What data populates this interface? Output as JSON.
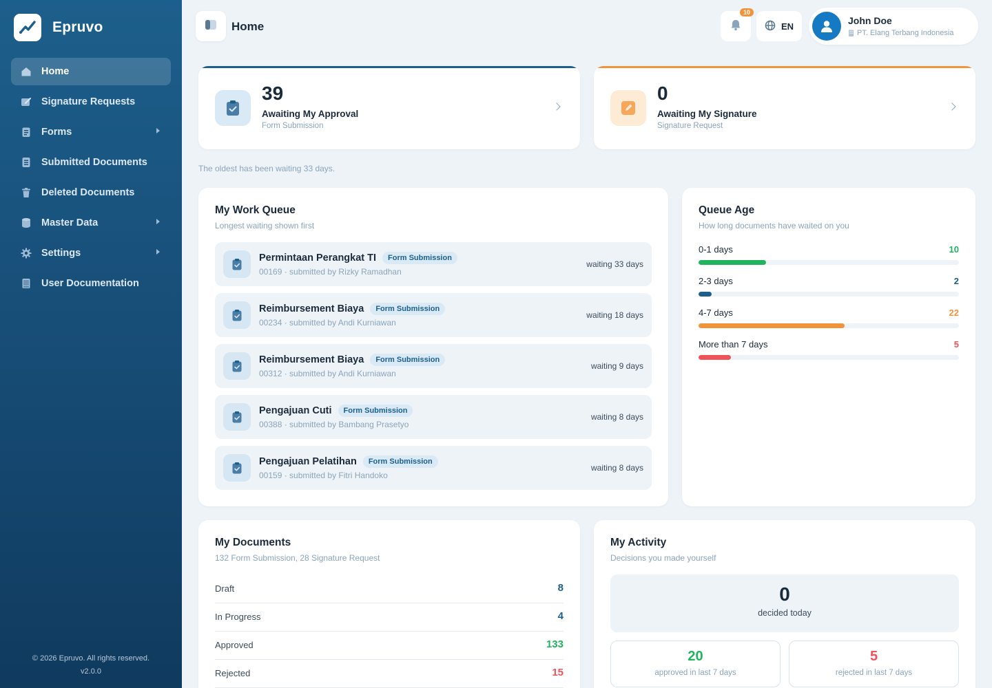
{
  "brand": {
    "name": "Epruvo"
  },
  "sidebar": {
    "items": [
      {
        "label": "Home",
        "icon": "home-icon"
      },
      {
        "label": "Signature Requests",
        "icon": "pen-icon"
      },
      {
        "label": "Forms",
        "icon": "form-icon"
      },
      {
        "label": "Submitted Documents",
        "icon": "document-icon"
      },
      {
        "label": "Deleted Documents",
        "icon": "trash-icon"
      },
      {
        "label": "Master Data",
        "icon": "database-icon"
      },
      {
        "label": "Settings",
        "icon": "gear-icon"
      },
      {
        "label": "User Documentation",
        "icon": "book-icon"
      }
    ],
    "footer_copyright": "© 2026 Epruvo. All rights reserved.",
    "footer_version": "v2.0.0"
  },
  "header": {
    "title": "Home",
    "notification_count": "10",
    "language": "EN",
    "user": {
      "name": "John Doe",
      "organization": "PT. Elang Terbang Indonesia"
    }
  },
  "stats": {
    "approval": {
      "value": "39",
      "label": "Awaiting My Approval",
      "sub": "Form Submission"
    },
    "signature": {
      "value": "0",
      "label": "Awaiting My Signature",
      "sub": "Signature Request"
    },
    "oldest_note": "The oldest has been waiting 33 days."
  },
  "work_queue": {
    "title": "My Work Queue",
    "subtitle": "Longest waiting shown first",
    "items": [
      {
        "title": "Permintaan Perangkat TI",
        "tag": "Form Submission",
        "meta": "00169 · submitted by Rizky Ramadhan",
        "wait": "waiting 33 days"
      },
      {
        "title": "Reimbursement Biaya",
        "tag": "Form Submission",
        "meta": "00234 · submitted by Andi Kurniawan",
        "wait": "waiting 18 days"
      },
      {
        "title": "Reimbursement Biaya",
        "tag": "Form Submission",
        "meta": "00312 · submitted by Andi Kurniawan",
        "wait": "waiting 9 days"
      },
      {
        "title": "Pengajuan Cuti",
        "tag": "Form Submission",
        "meta": "00388 · submitted by Bambang Prasetyo",
        "wait": "waiting 8 days"
      },
      {
        "title": "Pengajuan Pelatihan",
        "tag": "Form Submission",
        "meta": "00159 · submitted by Fitri Handoko",
        "wait": "waiting 8 days"
      }
    ]
  },
  "queue_age": {
    "title": "Queue Age",
    "subtitle": "How long documents have waited on you",
    "rows": [
      {
        "label": "0-1 days",
        "count": "10",
        "fill": 0.26,
        "color": "#22b35e"
      },
      {
        "label": "2-3 days",
        "count": "2",
        "fill": 0.05,
        "color": "#1d5f8c"
      },
      {
        "label": "4-7 days",
        "count": "22",
        "fill": 0.56,
        "color": "#f0943c"
      },
      {
        "label": "More than 7 days",
        "count": "5",
        "fill": 0.125,
        "color": "#f0525a"
      }
    ]
  },
  "my_documents": {
    "title": "My Documents",
    "subtitle": "132 Form Submission, 28 Signature Request",
    "rows": [
      {
        "label": "Draft",
        "value": "8",
        "color": "#1d5f8c"
      },
      {
        "label": "In Progress",
        "value": "4",
        "color": "#1d5f8c"
      },
      {
        "label": "Approved",
        "value": "133",
        "color": "#22b35e"
      },
      {
        "label": "Rejected",
        "value": "15",
        "color": "#f0525a"
      }
    ]
  },
  "activity": {
    "title": "My Activity",
    "subtitle": "Decisions you made yourself",
    "today_value": "0",
    "today_label": "decided today",
    "approved_value": "20",
    "approved_label": "approved in last 7 days",
    "rejected_value": "5",
    "rejected_label": "rejected in last 7 days"
  },
  "colors": {
    "sidebar": "#1d5f8c",
    "accent_blue": "#1d5f8c",
    "accent_orange": "#f0943c",
    "success": "#22b35e",
    "danger": "#f0525a"
  }
}
